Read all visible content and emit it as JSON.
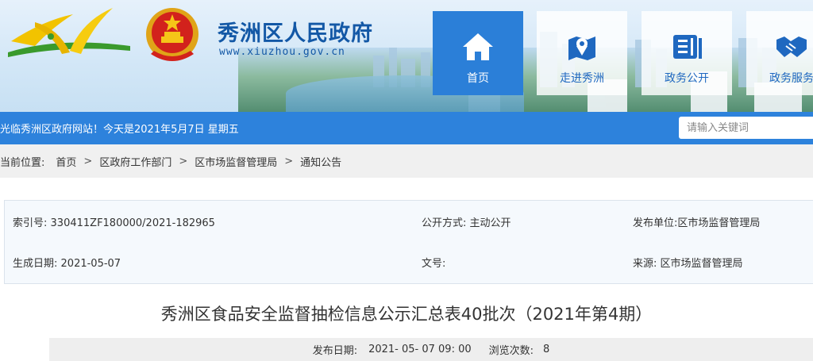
{
  "header": {
    "site_title": "秀洲区人民政府",
    "site_url": "www.xiuzhou.gov.cn",
    "colors": {
      "title": "#1358a6",
      "nav_active": "#2b7fd8",
      "bar": "#2d82dc"
    },
    "nav": [
      {
        "label": "首页",
        "icon": "home-icon",
        "active": true
      },
      {
        "label": "走进秀洲",
        "icon": "map-pin-icon",
        "active": false
      },
      {
        "label": "政务公开",
        "icon": "gov-info-icon",
        "active": false
      },
      {
        "label": "政务服务",
        "icon": "handshake-icon",
        "active": false
      }
    ]
  },
  "bar": {
    "welcome": "光临秀洲区政府网站！今天是2021年5月7日 星期五",
    "search_placeholder": "请输入关键词"
  },
  "breadcrumb": {
    "label": "当前位置:",
    "items": [
      "首页",
      "区政府工作部门",
      "区市场监督管理局",
      "通知公告"
    ]
  },
  "info": {
    "index_label": "索引号:",
    "index_value": "330411ZF180000/2021-182965",
    "open_mode_label": "公开方式:",
    "open_mode_value": "主动公开",
    "publisher_label": "发布单位:",
    "publisher_value": "区市场监督管理局",
    "date_label": "生成日期:",
    "date_value": "2021-05-07",
    "doc_no_label": "文号:",
    "doc_no_value": "",
    "source_label": "来源:",
    "source_value": "区市场监督管理局"
  },
  "article": {
    "title": "秀洲区食品安全监督抽检信息公示汇总表40批次（2021年第4期）",
    "publish_label": "发布日期:",
    "publish_value": "2021- 05- 07 09: 00",
    "views_label": "浏览次数:",
    "views_value": "8"
  }
}
